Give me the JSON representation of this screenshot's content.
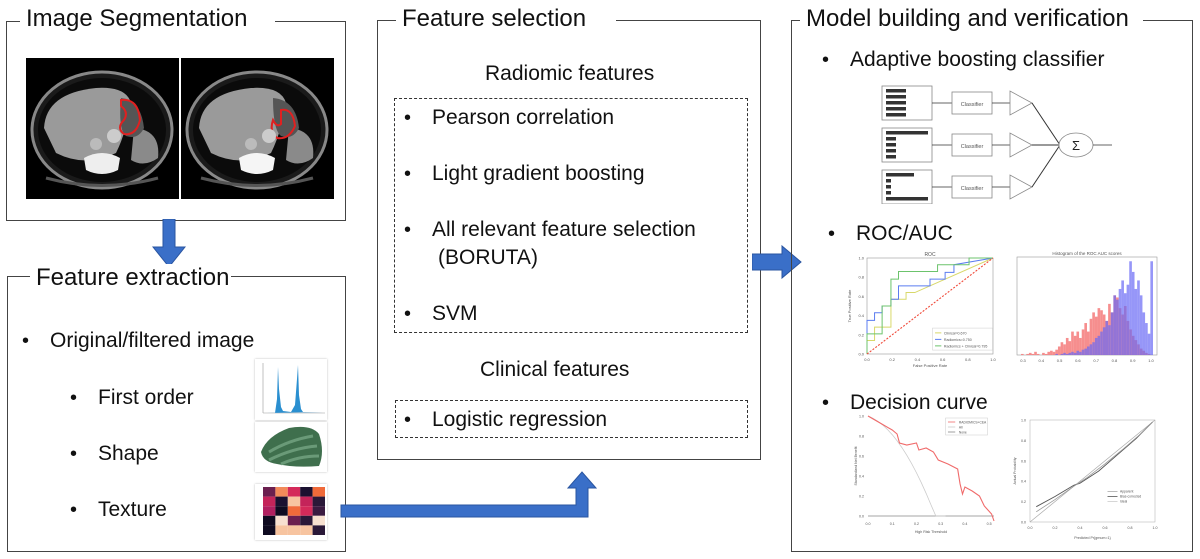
{
  "panels": {
    "segmentation": {
      "title": "Image Segmentation",
      "images": [
        "ct-scan-with-tumor-contour",
        "ct-scan-with-tumor-contour"
      ]
    },
    "extraction": {
      "title": "Feature extraction",
      "main_item": "Original/filtered image",
      "sub_items": [
        {
          "label": "First order",
          "thumb": "histogram-thumbnail"
        },
        {
          "label": "Shape",
          "thumb": "shape-thumbnail"
        },
        {
          "label": "Texture",
          "thumb": "texture-heatmap-thumbnail"
        }
      ]
    },
    "selection": {
      "title": "Feature selection",
      "radiomic_heading": "Radiomic features",
      "radiomic_items": [
        "Pearson correlation",
        "Light gradient boosting",
        "All relevant feature selection",
        "SVM"
      ],
      "radiomic_item_continuation": "(BORUTA)",
      "clinical_heading": "Clinical features",
      "clinical_items": [
        "Logistic regression"
      ]
    },
    "model": {
      "title": "Model building and verification",
      "items": [
        "Adaptive boosting classifier",
        "ROC/AUC",
        "Decision curve"
      ],
      "adaboost": {
        "classifier_label": "Classifier",
        "sum_symbol": "Σ",
        "rows": 3
      },
      "roc": {
        "title": "ROC",
        "xlabel": "False Positive Rate",
        "ylabel": "True Positive Rate",
        "ticks": [
          "0.0",
          "0.2",
          "0.4",
          "0.6",
          "0.8",
          "1.0"
        ],
        "legend": [
          "Clinical=0.670",
          "Radiomics=0.750",
          "Radiomics + Clinical=0.795"
        ],
        "colors": [
          "#d8d86a",
          "#5b7cf0",
          "#6cc36c",
          "#f04a3a"
        ]
      },
      "histogram": {
        "title": "Histogram of the ROC AUC scores",
        "xticks": [
          "0.3",
          "0.4",
          "0.5",
          "0.6",
          "0.7",
          "0.8",
          "0.9",
          "1.0"
        ],
        "colors": [
          "#f47a7a",
          "#6a6af5",
          "#8a4cc0"
        ]
      },
      "decision": {
        "xlabel": "High Risk Threshold",
        "ylabel": "Standardized Net Benefit",
        "xticks": [
          "0.0",
          "0.1",
          "0.2",
          "0.3",
          "0.4",
          "0.5"
        ],
        "yticks": [
          "0.0",
          "0.2",
          "0.4",
          "0.6",
          "0.8",
          "1.0"
        ],
        "legend": [
          "RADIOMICS+CEA",
          "All",
          "None"
        ],
        "colors": [
          "#f06a6a",
          "#cccccc",
          "#888888"
        ]
      },
      "calibration": {
        "xlabel": "Predicted Pr{grnum=1}",
        "ylabel": "Actual Probability",
        "xticks": [
          "0.0",
          "0.2",
          "0.4",
          "0.6",
          "0.8",
          "1.0"
        ],
        "legend": [
          "Apparent",
          "Bias-corrected",
          "Ideal"
        ]
      }
    }
  },
  "arrows": {
    "color": "#3a6fc8",
    "segmentation_to_extraction": "down",
    "extraction_to_selection": "elbow-up",
    "selection_to_model": "right"
  }
}
